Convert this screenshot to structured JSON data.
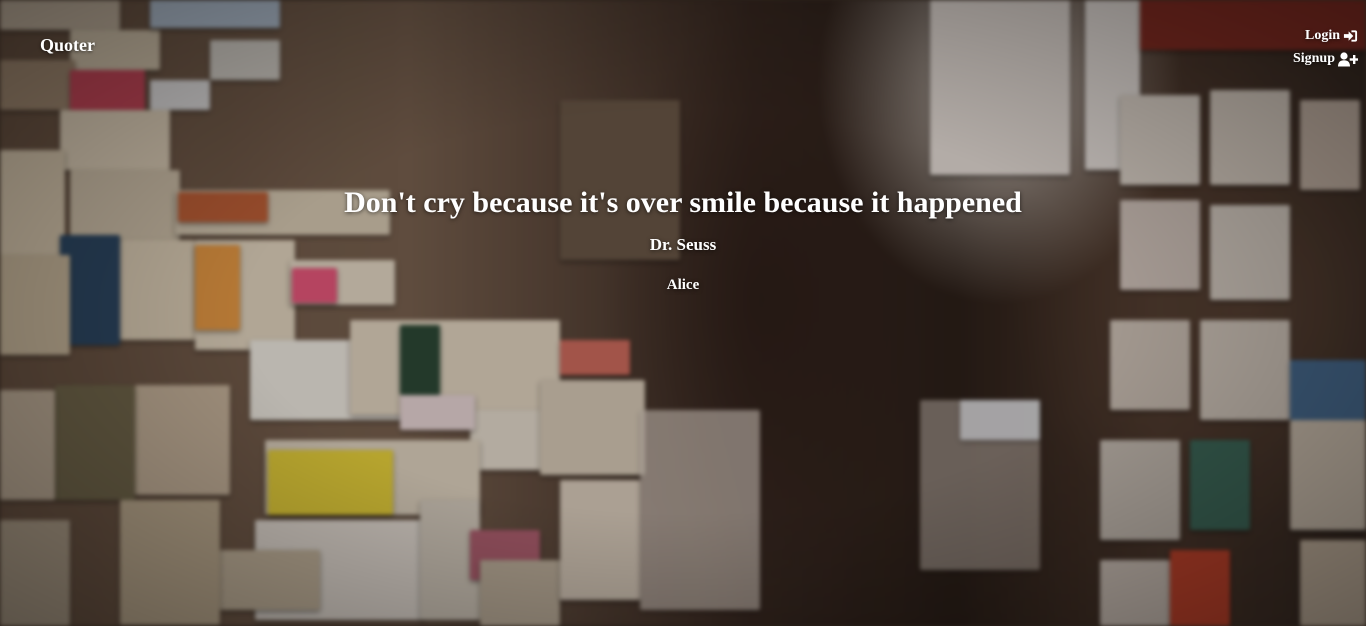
{
  "navbar": {
    "brand": "Quoter",
    "login_label": "Login",
    "login_icon": "sign-in-icon",
    "signup_label": "Signup",
    "signup_icon": "user-plus-icon"
  },
  "quote": {
    "text": "Don't cry because it's over smile because it happened",
    "author": "Dr. Seuss",
    "posted_by": "Alice"
  },
  "colors": {
    "text": "#ffffff"
  }
}
